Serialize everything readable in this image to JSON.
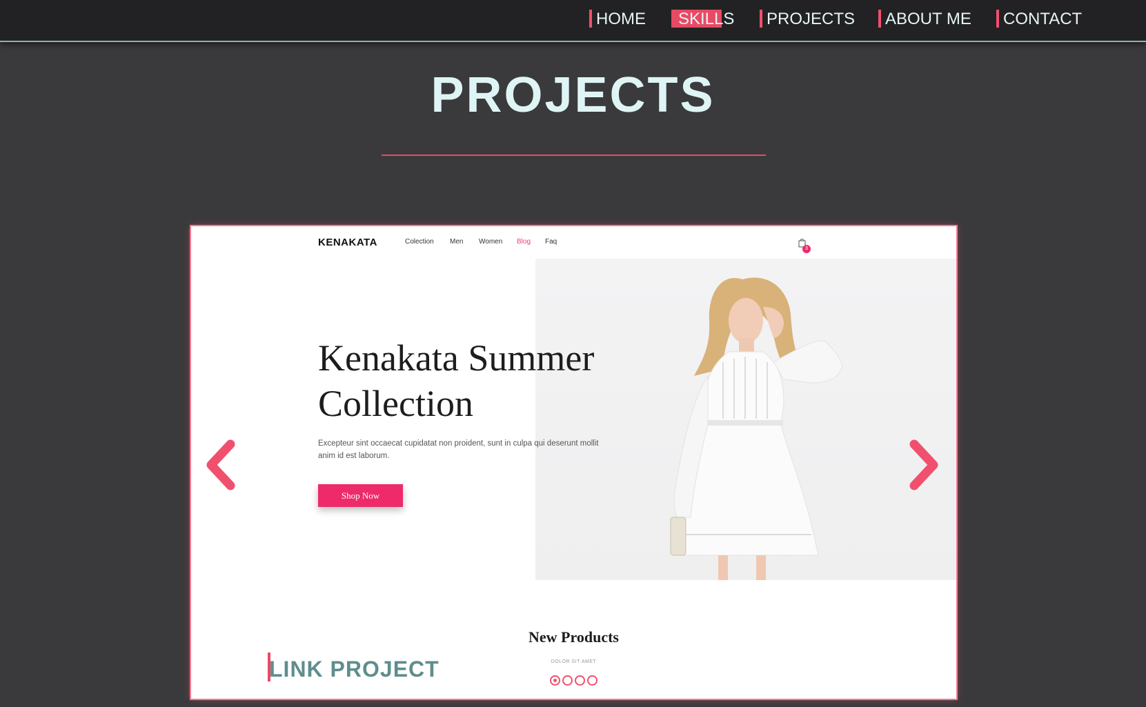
{
  "nav": {
    "items": [
      {
        "label": "HOME"
      },
      {
        "label": "SKILLS"
      },
      {
        "label": "PROJECTS"
      },
      {
        "label": "ABOUT ME"
      },
      {
        "label": "CONTACT"
      }
    ],
    "active": "SKILLS"
  },
  "page": {
    "title": "PROJECTS"
  },
  "project": {
    "site": {
      "logo": "KENAKATA",
      "menu": [
        "Colection",
        "Men",
        "Women",
        "Blog",
        "Faq"
      ],
      "menu_highlight": "Blog",
      "cart_count": "3",
      "hero_title_line1": "Kenakata Summer",
      "hero_title_line2": "Collection",
      "hero_text": "Excepteur sint occaecat cupidatat non proident, sunt in culpa qui deserunt mollit anim id est laborum.",
      "shop_button": "Shop Now",
      "section_title": "New Products",
      "section_subtitle": "DOLOR SIT AMET"
    },
    "link_label": "LINK PROJECT",
    "carousel": {
      "slide_count": 4,
      "active_slide": 1
    }
  },
  "colors": {
    "background": "#3a3a3c",
    "nav_background": "#222224",
    "accent": "#f0506e",
    "title": "#dff5f5",
    "link": "#5e8e8d",
    "brand_pink": "#ee2a6a"
  },
  "icons": {
    "prev": "chevron-left-icon",
    "next": "chevron-right-icon",
    "cart": "shopping-bag-icon"
  }
}
